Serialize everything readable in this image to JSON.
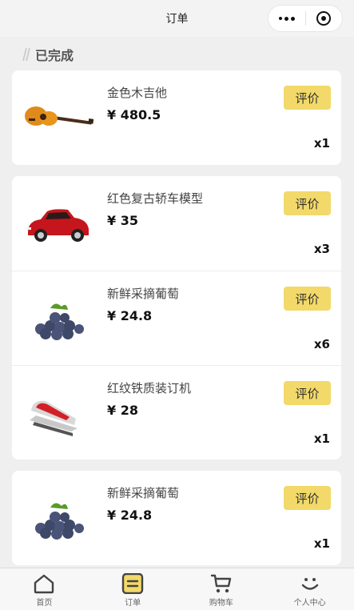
{
  "nav": {
    "title": "订单"
  },
  "section": {
    "label": "已完成"
  },
  "cards": [
    {
      "items": [
        {
          "name": "金色木吉他",
          "price": "¥ 480.5",
          "qty": "x1",
          "action": "评价",
          "icon": "guitar-icon"
        }
      ]
    },
    {
      "items": [
        {
          "name": "红色复古轿车模型",
          "price": "¥ 35",
          "qty": "x3",
          "action": "评价",
          "icon": "car-icon"
        },
        {
          "name": "新鲜采摘葡萄",
          "price": "¥ 24.8",
          "qty": "x6",
          "action": "评价",
          "icon": "grapes-icon"
        },
        {
          "name": "红纹铁质装订机",
          "price": "¥ 28",
          "qty": "x1",
          "action": "评价",
          "icon": "stapler-icon"
        }
      ]
    },
    {
      "items": [
        {
          "name": "新鲜采摘葡萄",
          "price": "¥ 24.8",
          "qty": "x1",
          "action": "评价",
          "icon": "grapes-icon"
        }
      ]
    }
  ],
  "tabs": [
    {
      "label": "首页",
      "icon": "home-icon"
    },
    {
      "label": "订单",
      "icon": "order-icon",
      "active": true
    },
    {
      "label": "购物车",
      "icon": "cart-icon"
    },
    {
      "label": "个人中心",
      "icon": "smile-icon"
    }
  ],
  "colors": {
    "accent": "#f2d969",
    "background": "#efefef"
  }
}
